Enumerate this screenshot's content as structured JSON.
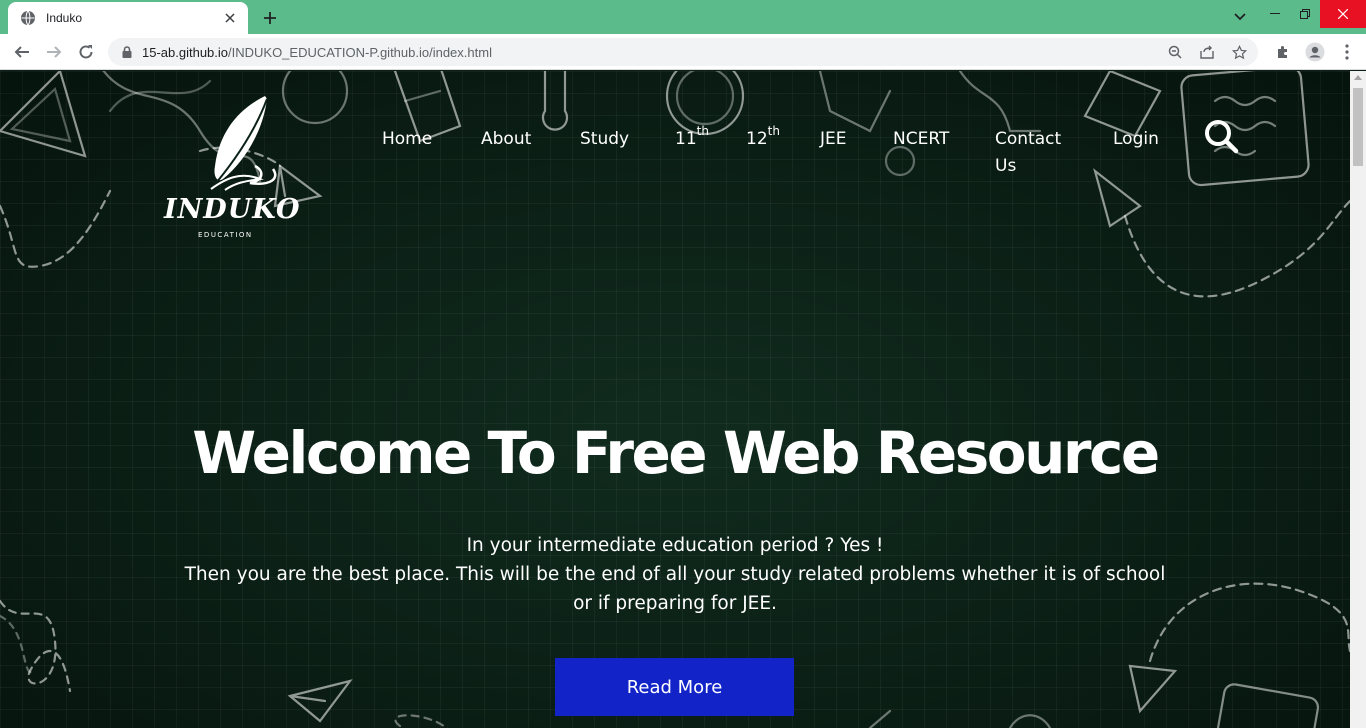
{
  "browser": {
    "tab_title": "Induko",
    "url_host": "15-ab.github.io",
    "url_path": "/INDUKO_EDUCATION-P.github.io/index.html"
  },
  "logo": {
    "name": "INDUKO",
    "subtitle": "EDUCATION"
  },
  "nav": {
    "home": "Home",
    "about": "About",
    "study": "Study",
    "eleventh": "11",
    "eleventh_sup": "th",
    "twelfth": "12",
    "twelfth_sup": "th",
    "jee": "JEE",
    "ncert": "NCERT",
    "contact_line1": "Contact",
    "contact_line2": "Us",
    "login": "Login"
  },
  "hero": {
    "title": "Welcome To Free Web Resource",
    "line1": "In your intermediate education period ? Yes !",
    "line2": "Then you are the best place. This will be the end of all your study related problems whether it is of school",
    "line3": "or if preparing for JEE.",
    "button": "Read More"
  },
  "colors": {
    "tabbar": "#5cbb8a",
    "page_bg": "#0c2218",
    "button_bg": "#1224c8"
  }
}
